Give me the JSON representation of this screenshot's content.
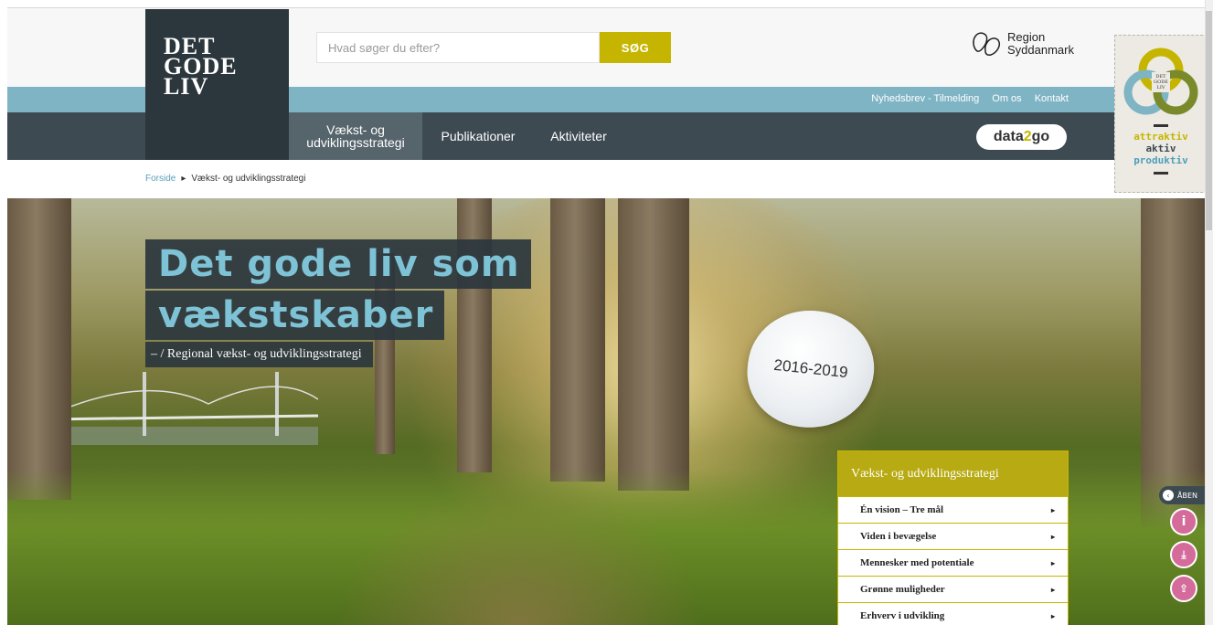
{
  "header": {
    "logo_lines": [
      "DET",
      "GODE",
      "LIV"
    ],
    "search_placeholder": "Hvad søger du efter?",
    "search_button": "SØG",
    "region_logo": {
      "line1": "Region",
      "line2": "Syddanmark"
    }
  },
  "utility_nav": [
    "Nyhedsbrev - Tilmelding",
    "Om os",
    "Kontakt"
  ],
  "main_nav": [
    {
      "label_line1": "Vækst- og",
      "label_line2": "udviklingsstrategi",
      "active": true
    },
    {
      "label": "Publikationer"
    },
    {
      "label": "Aktiviteter"
    }
  ],
  "data2go": {
    "before": "data",
    "two": "2",
    "after": "go"
  },
  "breadcrumb": {
    "home": "Forside",
    "current": "Vækst- og udviklingsstrategi"
  },
  "hero": {
    "title_line1": "Det gode liv som",
    "title_line2": "vækstskaber",
    "subtitle": "– / Regional vækst- og udviklingsstrategi",
    "badge": "2016-2019"
  },
  "strategy_panel": {
    "title": "Vækst- og udviklingsstrategi",
    "items": [
      "Én vision – Tre mål",
      "Viden i bevægelse",
      "Mennesker med potentiale",
      "Grønne muligheder",
      "Erhverv i udvikling"
    ]
  },
  "side_tag": {
    "words": [
      "attraktiv",
      "aktiv",
      "produktiv"
    ]
  },
  "side_tools": {
    "open_label": "ÅBEN",
    "icons": [
      "info-icon",
      "download-icon",
      "share-icon"
    ]
  },
  "colors": {
    "accent": "#c6b500",
    "dark": "#3d4a52",
    "light_blue": "#7fb4c4",
    "pink": "#d46b9b"
  }
}
